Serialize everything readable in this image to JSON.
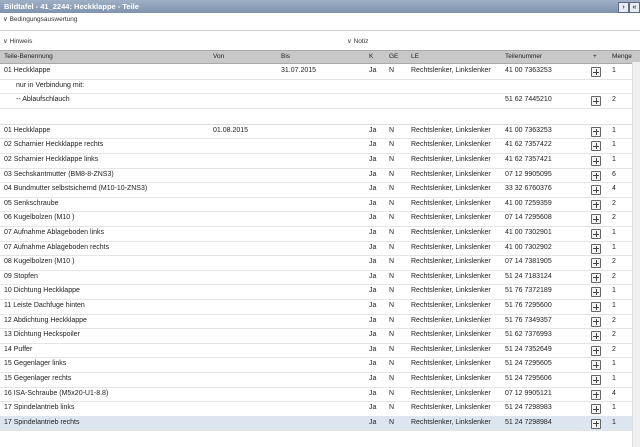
{
  "title": "Bildtafel - 41_2244: Heckklappe - Teile",
  "sections": {
    "bedingung": "Bedingungsauswertung",
    "hinweis": "Hinweis",
    "notiz": "Notiz"
  },
  "columns": [
    "Teile-Benennung",
    "Von",
    "Bis",
    "K",
    "GE",
    "LE",
    "Teilenummer",
    "+",
    "Menge"
  ],
  "rows": [
    {
      "name": "01 Heckklappe",
      "von": "",
      "bis": "31.07.2015",
      "k": "Ja",
      "ge": "N",
      "le": "Rechtslenker, Linkslenker",
      "nr": "41 00 7363253",
      "plus": true,
      "menge": "1"
    },
    {
      "name": "nur in Verbindung mit:",
      "indent": true,
      "von": "",
      "bis": "",
      "k": "",
      "ge": "",
      "le": "",
      "nr": "",
      "plus": false,
      "menge": ""
    },
    {
      "name": "-- Ablaufschlauch",
      "indent": true,
      "von": "",
      "bis": "",
      "k": "",
      "ge": "",
      "le": "",
      "nr": "51 62 7445210",
      "plus": true,
      "menge": "2"
    },
    {
      "spacer": true
    },
    {
      "name": "01 Heckklappe",
      "von": "01.08.2015",
      "bis": "",
      "k": "Ja",
      "ge": "N",
      "le": "Rechtslenker, Linkslenker",
      "nr": "41 00 7363253",
      "plus": true,
      "menge": "1"
    },
    {
      "name": "02 Scharnier Heckklappe rechts",
      "von": "",
      "bis": "",
      "k": "Ja",
      "ge": "N",
      "le": "Rechtslenker, Linkslenker",
      "nr": "41 62 7357422",
      "plus": true,
      "menge": "1"
    },
    {
      "name": "02 Scharnier Heckklappe links",
      "von": "",
      "bis": "",
      "k": "Ja",
      "ge": "N",
      "le": "Rechtslenker, Linkslenker",
      "nr": "41 62 7357421",
      "plus": true,
      "menge": "1"
    },
    {
      "name": "03 Sechskantmutter (BM8-8-ZNS3)",
      "von": "",
      "bis": "",
      "k": "Ja",
      "ge": "N",
      "le": "Rechtslenker, Linkslenker",
      "nr": "07 12 9905095",
      "plus": true,
      "menge": "6"
    },
    {
      "name": "04 Bundmutter selbstsichernd (M10-10-ZNS3)",
      "von": "",
      "bis": "",
      "k": "Ja",
      "ge": "N",
      "le": "Rechtslenker, Linkslenker",
      "nr": "33 32 6760376",
      "plus": true,
      "menge": "4"
    },
    {
      "name": "05 Senkschraube",
      "von": "",
      "bis": "",
      "k": "Ja",
      "ge": "N",
      "le": "Rechtslenker, Linkslenker",
      "nr": "41 00 7259359",
      "plus": true,
      "menge": "2"
    },
    {
      "name": "06 Kugelbolzen (M10 )",
      "von": "",
      "bis": "",
      "k": "Ja",
      "ge": "N",
      "le": "Rechtslenker, Linkslenker",
      "nr": "07 14 7295608",
      "plus": true,
      "menge": "2"
    },
    {
      "name": "07 Aufnahme Ablageboden links",
      "von": "",
      "bis": "",
      "k": "Ja",
      "ge": "N",
      "le": "Rechtslenker, Linkslenker",
      "nr": "41 00 7302901",
      "plus": true,
      "menge": "1"
    },
    {
      "name": "07 Aufnahme Ablageboden rechts",
      "von": "",
      "bis": "",
      "k": "Ja",
      "ge": "N",
      "le": "Rechtslenker, Linkslenker",
      "nr": "41 00 7302902",
      "plus": true,
      "menge": "1"
    },
    {
      "name": "08 Kugelbolzen (M10 )",
      "von": "",
      "bis": "",
      "k": "Ja",
      "ge": "N",
      "le": "Rechtslenker, Linkslenker",
      "nr": "07 14 7381905",
      "plus": true,
      "menge": "2"
    },
    {
      "name": "09 Stopfen",
      "von": "",
      "bis": "",
      "k": "Ja",
      "ge": "N",
      "le": "Rechtslenker, Linkslenker",
      "nr": "51 24 7183124",
      "plus": true,
      "menge": "2"
    },
    {
      "name": "10 Dichtung Heckklappe",
      "von": "",
      "bis": "",
      "k": "Ja",
      "ge": "N",
      "le": "Rechtslenker, Linkslenker",
      "nr": "51 76 7372189",
      "plus": true,
      "menge": "1"
    },
    {
      "name": "11 Leiste Dachfuge hinten",
      "von": "",
      "bis": "",
      "k": "Ja",
      "ge": "N",
      "le": "Rechtslenker, Linkslenker",
      "nr": "51 76 7295600",
      "plus": true,
      "menge": "1"
    },
    {
      "name": "12 Abdichtung Heckklappe",
      "von": "",
      "bis": "",
      "k": "Ja",
      "ge": "N",
      "le": "Rechtslenker, Linkslenker",
      "nr": "51 76 7349357",
      "plus": true,
      "menge": "2"
    },
    {
      "name": "13 Dichtung Heckspoiler",
      "von": "",
      "bis": "",
      "k": "Ja",
      "ge": "N",
      "le": "Rechtslenker, Linkslenker",
      "nr": "51 62 7376993",
      "plus": true,
      "menge": "2"
    },
    {
      "name": "14 Puffer",
      "von": "",
      "bis": "",
      "k": "Ja",
      "ge": "N",
      "le": "Rechtslenker, Linkslenker",
      "nr": "51 24 7352649",
      "plus": true,
      "menge": "2"
    },
    {
      "name": "15 Gegenlager links",
      "von": "",
      "bis": "",
      "k": "Ja",
      "ge": "N",
      "le": "Rechtslenker, Linkslenker",
      "nr": "51 24 7295605",
      "plus": true,
      "menge": "1"
    },
    {
      "name": "15 Gegenlager rechts",
      "von": "",
      "bis": "",
      "k": "Ja",
      "ge": "N",
      "le": "Rechtslenker, Linkslenker",
      "nr": "51 24 7295606",
      "plus": true,
      "menge": "1"
    },
    {
      "name": "16 ISA-Schraube (M5x20-U1-8.8)",
      "von": "",
      "bis": "",
      "k": "Ja",
      "ge": "N",
      "le": "Rechtslenker, Linkslenker",
      "nr": "07 12 9905121",
      "plus": true,
      "menge": "4"
    },
    {
      "name": "17 Spindelantrieb links",
      "von": "",
      "bis": "",
      "k": "Ja",
      "ge": "N",
      "le": "Rechtslenker, Linkslenker",
      "nr": "51 24 7298983",
      "plus": true,
      "menge": "1"
    },
    {
      "name": "17 Spindelantrieb rechts",
      "von": "",
      "bis": "",
      "k": "Ja",
      "ge": "N",
      "le": "Rechtslenker, Linkslenker",
      "nr": "51 24 7298984",
      "plus": true,
      "menge": "1",
      "selected": true
    }
  ]
}
